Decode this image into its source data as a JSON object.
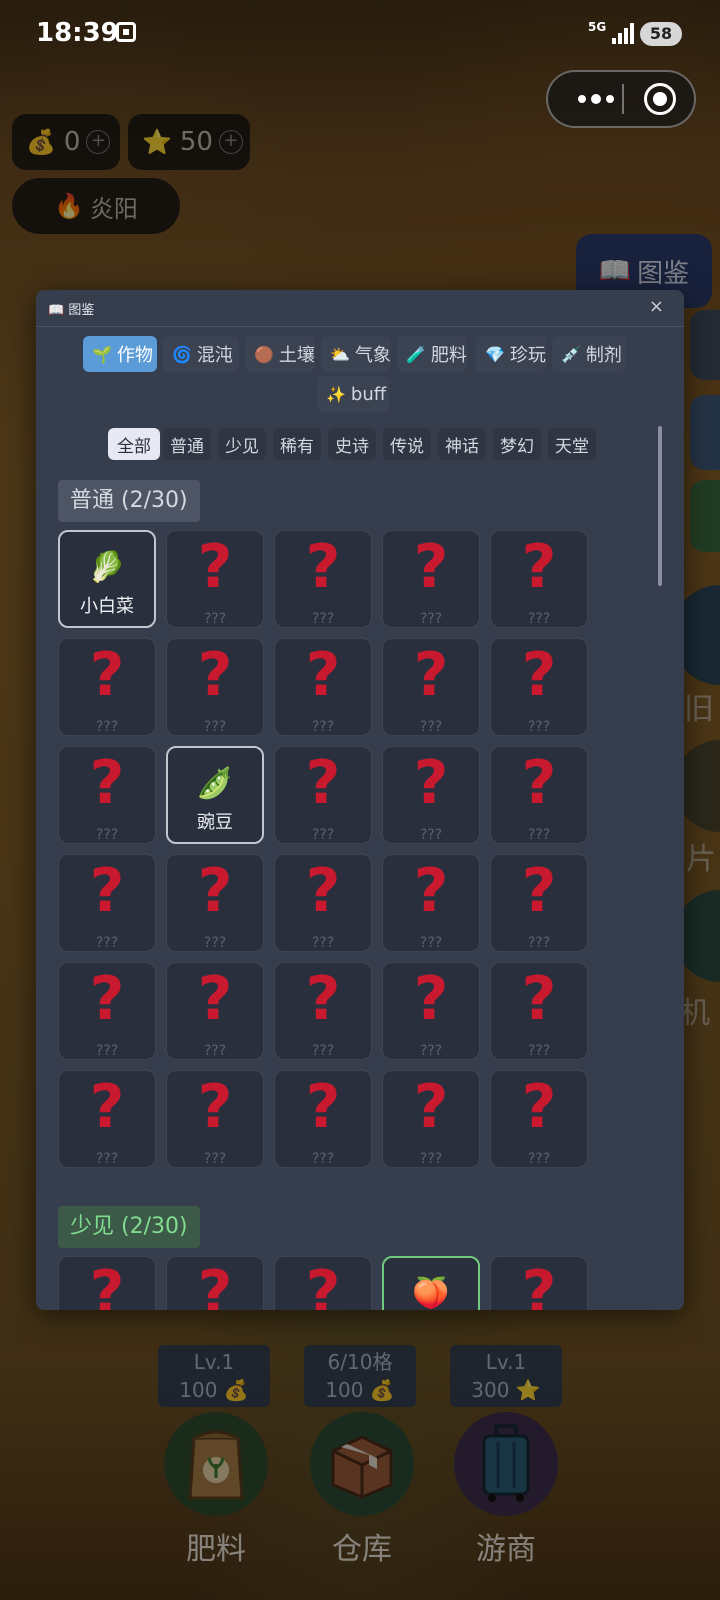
{
  "status_bar": {
    "time": "18:39",
    "network": "5G",
    "battery": "58"
  },
  "resources": {
    "money": "0",
    "stars": "50",
    "plus": "+",
    "weather": "炎阳"
  },
  "side_panel": {
    "guide_label": "图鉴",
    "partial_label_1": "旧",
    "partial_label_2": "片",
    "partial_label_3": "机"
  },
  "modal": {
    "title": "图鉴",
    "close": "×",
    "categories": [
      {
        "label": "作物",
        "icon": "🌱"
      },
      {
        "label": "混沌",
        "icon": "🌀"
      },
      {
        "label": "土壤",
        "icon": "🟤"
      },
      {
        "label": "气象",
        "icon": "⛅"
      },
      {
        "label": "肥料",
        "icon": "🧪"
      },
      {
        "label": "珍玩",
        "icon": "💎"
      },
      {
        "label": "制剂",
        "icon": "💉"
      },
      {
        "label": "buff",
        "icon": "✨"
      }
    ],
    "rarity_tabs": [
      "全部",
      "普通",
      "少见",
      "稀有",
      "史诗",
      "传说",
      "神话",
      "梦幻",
      "天堂"
    ],
    "sections": [
      {
        "title": "普通 (2/30)",
        "items": [
          {
            "found": true,
            "name": "小白菜",
            "icon": "🥬"
          },
          {
            "found": false
          },
          {
            "found": false
          },
          {
            "found": false
          },
          {
            "found": false
          },
          {
            "found": false
          },
          {
            "found": false
          },
          {
            "found": false
          },
          {
            "found": false
          },
          {
            "found": false
          },
          {
            "found": false
          },
          {
            "found": true,
            "name": "豌豆",
            "icon": "🫛"
          },
          {
            "found": false
          },
          {
            "found": false
          },
          {
            "found": false
          },
          {
            "found": false
          },
          {
            "found": false
          },
          {
            "found": false
          },
          {
            "found": false
          },
          {
            "found": false
          },
          {
            "found": false
          },
          {
            "found": false
          },
          {
            "found": false
          },
          {
            "found": false
          },
          {
            "found": false
          },
          {
            "found": false
          },
          {
            "found": false
          },
          {
            "found": false
          },
          {
            "found": false
          },
          {
            "found": false
          }
        ]
      },
      {
        "title": "少见 (2/30)",
        "items": [
          {
            "found": false
          },
          {
            "found": false
          },
          {
            "found": false
          },
          {
            "found": true,
            "name": "",
            "icon": "🍑"
          },
          {
            "found": false
          }
        ]
      }
    ],
    "unknown_mark": "?",
    "unknown_label": "???"
  },
  "dock": [
    {
      "level": "Lv.1",
      "cost": "100 💰",
      "label": "肥料",
      "icon": "fertilizer-bag-icon"
    },
    {
      "level": "6/10格",
      "cost": "100 💰",
      "label": "仓库",
      "icon": "box-icon"
    },
    {
      "level": "Lv.1",
      "cost": "300 ⭐",
      "label": "游商",
      "icon": "suitcase-icon"
    }
  ]
}
